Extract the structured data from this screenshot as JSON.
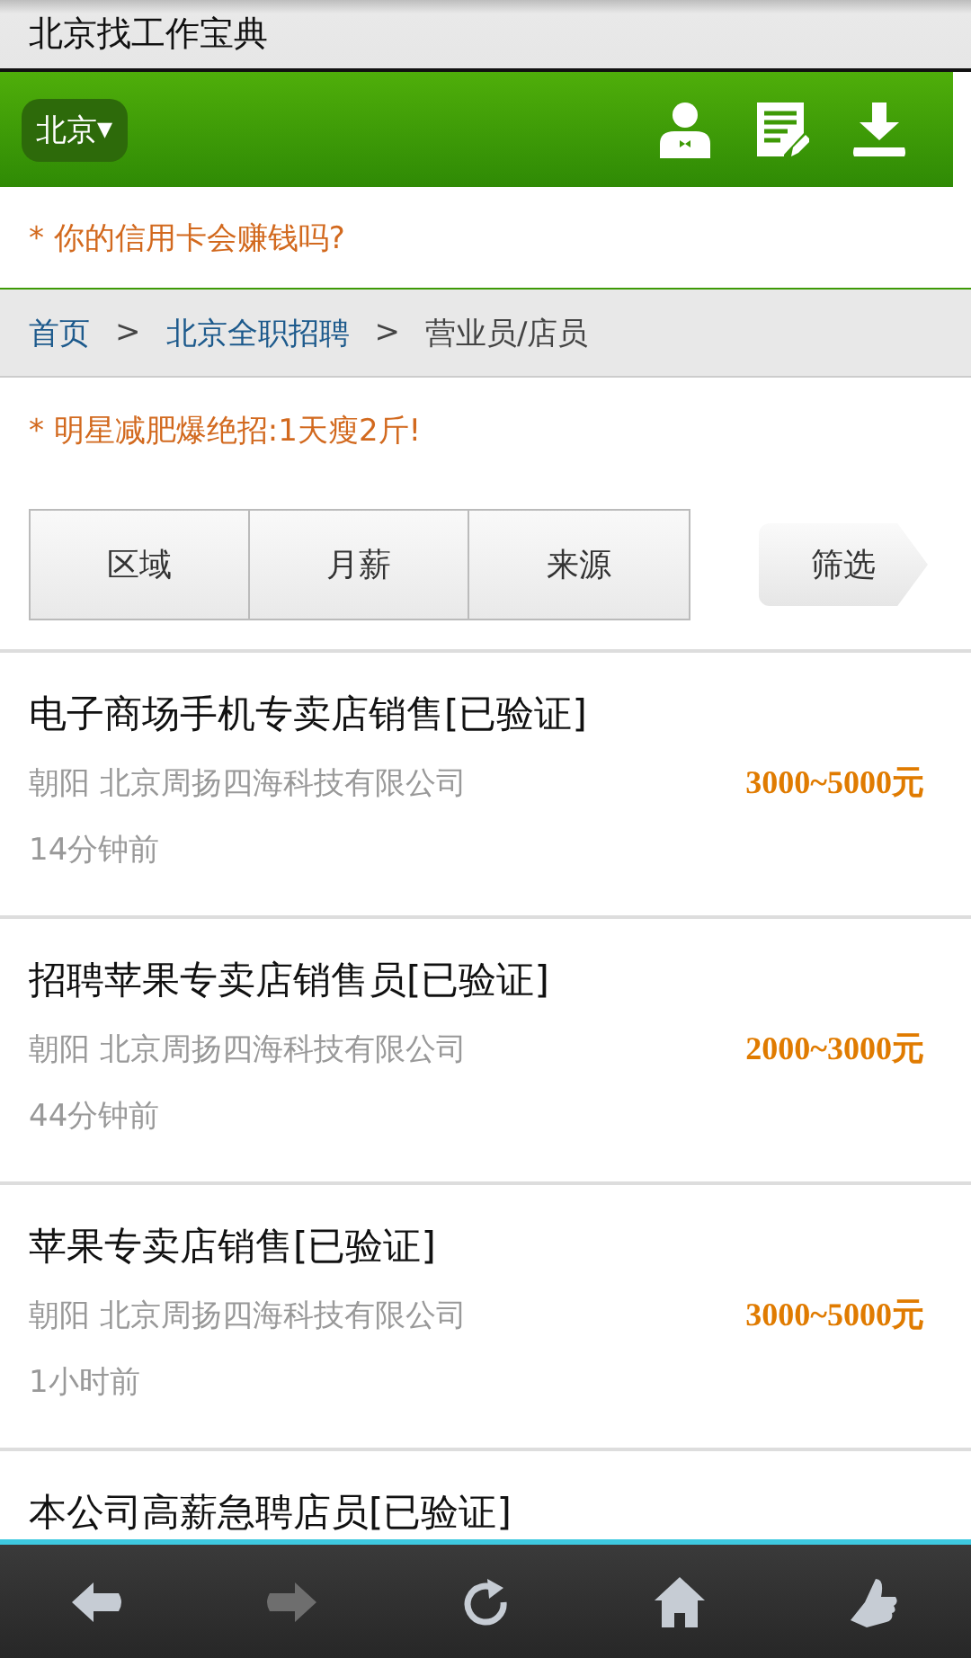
{
  "window": {
    "title": "北京找工作宝典"
  },
  "header": {
    "city": "北京",
    "caret": "▾",
    "icons": [
      {
        "kind": "user"
      },
      {
        "kind": "edit"
      },
      {
        "kind": "download"
      }
    ]
  },
  "ad_top": "* 你的信用卡会赚钱吗?",
  "breadcrumb": [
    {
      "label": "首页",
      "link": true
    },
    {
      "label": ">",
      "link": false
    },
    {
      "label": "北京全职招聘",
      "link": true
    },
    {
      "label": ">",
      "link": false
    },
    {
      "label": "营业员/店员",
      "link": false
    }
  ],
  "ad_mid": "* 明星减肥爆绝招:1天瘦2斤!",
  "filters": [
    {
      "label": "区域"
    },
    {
      "label": "月薪"
    },
    {
      "label": "来源"
    }
  ],
  "filter_button": "筛选",
  "jobs": [
    {
      "title": "电子商场手机专卖店销售[已验证]",
      "company": "朝阳 北京周扬四海科技有限公司",
      "salary": "3000~5000元",
      "time": "14分钟前"
    },
    {
      "title": "招聘苹果专卖店销售员[已验证]",
      "company": "朝阳 北京周扬四海科技有限公司",
      "salary": "2000~3000元",
      "time": "44分钟前"
    },
    {
      "title": "苹果专卖店销售[已验证]",
      "company": "朝阳 北京周扬四海科技有限公司",
      "salary": "3000~5000元",
      "time": "1小时前"
    },
    {
      "title": "本公司高薪急聘店员[已验证]"
    }
  ],
  "toolbar": [
    {
      "kind": "back",
      "disabled": false
    },
    {
      "kind": "forward",
      "disabled": true
    },
    {
      "kind": "refresh",
      "disabled": false
    },
    {
      "kind": "home",
      "disabled": false
    },
    {
      "kind": "like",
      "disabled": false
    }
  ]
}
